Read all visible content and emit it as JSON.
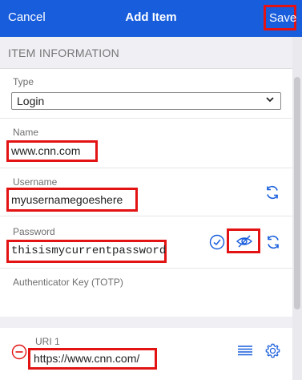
{
  "header": {
    "cancel_label": "Cancel",
    "title": "Add Item",
    "save_label": "Save"
  },
  "section": {
    "title": "ITEM INFORMATION"
  },
  "fields": {
    "type": {
      "label": "Type",
      "value": "Login"
    },
    "name": {
      "label": "Name",
      "value": "www.cnn.com"
    },
    "username": {
      "label": "Username",
      "value": "myusernamegoeshere"
    },
    "password": {
      "label": "Password",
      "value": "thisismycurrentpassword"
    },
    "totp": {
      "label": "Authenticator Key (TOTP)"
    },
    "uri": {
      "label": "URI 1",
      "value": "https://www.cnn.com/"
    }
  },
  "colors": {
    "header_bg": "#175ddc",
    "accent": "#175ddc",
    "highlight": "#e31313",
    "remove": "#e31313"
  },
  "icons": [
    "chevron-down-icon",
    "refresh-icon",
    "check-circle-icon",
    "eye-slash-icon",
    "remove-circle-icon",
    "list-icon",
    "gear-icon"
  ]
}
